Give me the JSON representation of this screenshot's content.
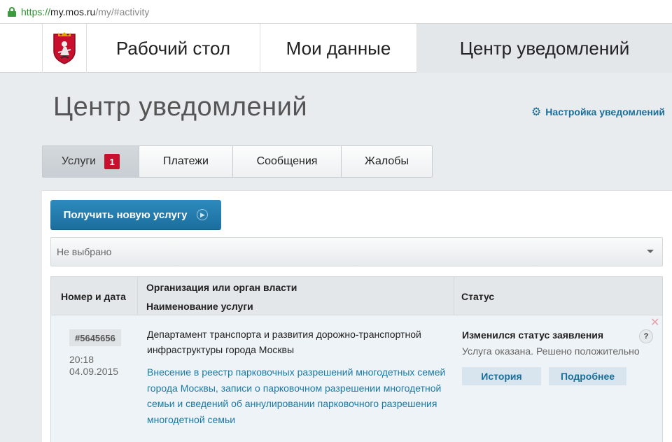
{
  "browser": {
    "url_scheme": "https://",
    "url_host": "my.mos.ru",
    "url_path": "/my/#activity"
  },
  "topnav": {
    "items": [
      {
        "label": "Рабочий стол"
      },
      {
        "label": "Мои данные"
      },
      {
        "label": "Центр уведомлений",
        "active": true
      }
    ]
  },
  "header": {
    "title": "Центр уведомлений",
    "settings_link": "Настройка уведомлений"
  },
  "tabs": [
    {
      "label": "Услуги",
      "badge": "1",
      "active": true
    },
    {
      "label": "Платежи"
    },
    {
      "label": "Сообщения"
    },
    {
      "label": "Жалобы"
    }
  ],
  "actions": {
    "new_service_label": "Получить новую услугу"
  },
  "filter": {
    "selected": "Не выбрано"
  },
  "table": {
    "headers": {
      "number_date": "Номер и дата",
      "organization": "Организация или орган власти",
      "service_name": "Наименование услуги",
      "status": "Статус"
    },
    "rows": [
      {
        "number": "#5645656",
        "time": "20:18",
        "date": "04.09.2015",
        "organization": "Департамент транспорта и развития дорожно-транспортной инфраструктуры города Москвы",
        "service": "Внесение в реестр парковочных разрешений многодетных семей города Москвы, записи о парковочном разрешении многодетной семьи и сведений об аннулировании парковочного разрешения многодетной семьи",
        "status_title": "Изменился статус заявления",
        "status_desc": "Услуга оказана. Решено положительно",
        "history_label": "История",
        "details_label": "Подробнее"
      }
    ]
  },
  "colors": {
    "accent": "#1b6e9d",
    "badge": "#c8102e",
    "link": "#1a7aa6"
  },
  "icons": [
    "lock-icon",
    "moscow-coat-of-arms-icon",
    "gear-icon",
    "arrow-circle-icon",
    "chevron-down-icon",
    "close-icon",
    "help-icon"
  ]
}
